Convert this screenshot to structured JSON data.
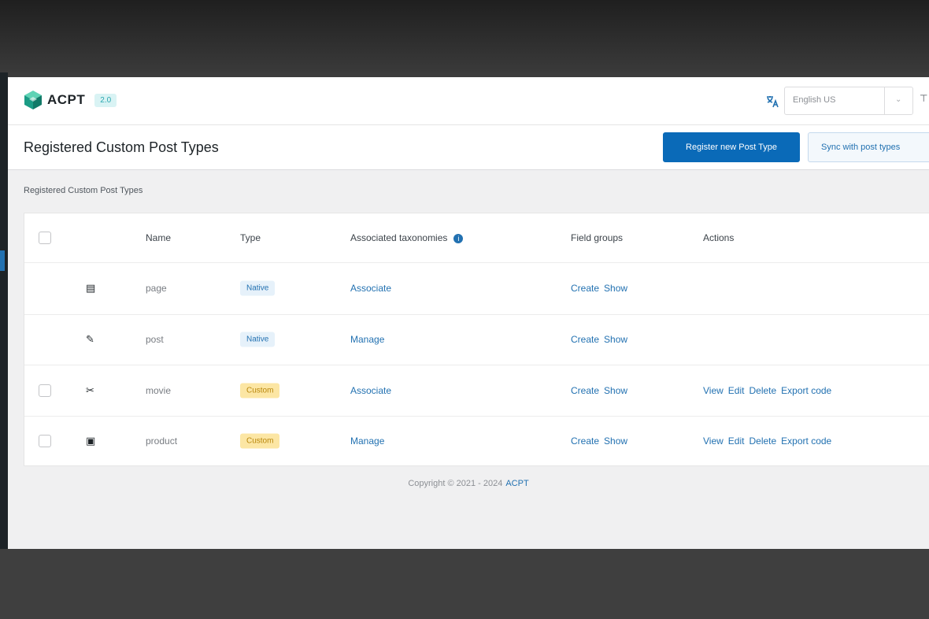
{
  "header": {
    "logo_text": "ACPT",
    "version": "2.0",
    "language_value": "English US",
    "clip_icon": "⊤"
  },
  "title_bar": {
    "page_title": "Registered Custom Post Types",
    "primary_button": "Register new Post Type",
    "secondary_button": "Sync with post types"
  },
  "breadcrumb": "Registered Custom Post Types",
  "table": {
    "columns": [
      "Name",
      "Type",
      "Associated taxonomies",
      "Field groups",
      "Actions"
    ],
    "rows": [
      {
        "icon": "▤",
        "name": "page",
        "type": "Native",
        "taxonomy_link": "Associate",
        "field_groups": [
          "Create",
          "Show"
        ],
        "actions": []
      },
      {
        "icon": "✎",
        "name": "post",
        "type": "Native",
        "taxonomy_link": "Manage",
        "field_groups": [
          "Create",
          "Show"
        ],
        "actions": []
      },
      {
        "icon": "✂",
        "name": "movie",
        "type": "Custom",
        "taxonomy_link": "Associate",
        "field_groups": [
          "Create",
          "Show"
        ],
        "actions": [
          "View",
          "Edit",
          "Delete",
          "Export code"
        ]
      },
      {
        "icon": "▣",
        "name": "product",
        "type": "Custom",
        "taxonomy_link": "Manage",
        "field_groups": [
          "Create",
          "Show"
        ],
        "actions": [
          "View",
          "Edit",
          "Delete",
          "Export code"
        ]
      }
    ]
  },
  "footer": {
    "copyright": "Copyright © 2021 - 2024",
    "brand": "ACPT"
  },
  "colors": {
    "primary": "#0a6ab8",
    "link": "#2271b1",
    "native_badge_bg": "#e6f1fa",
    "custom_badge_bg": "#fce6a4",
    "logo_accent": "#1b9c85"
  }
}
